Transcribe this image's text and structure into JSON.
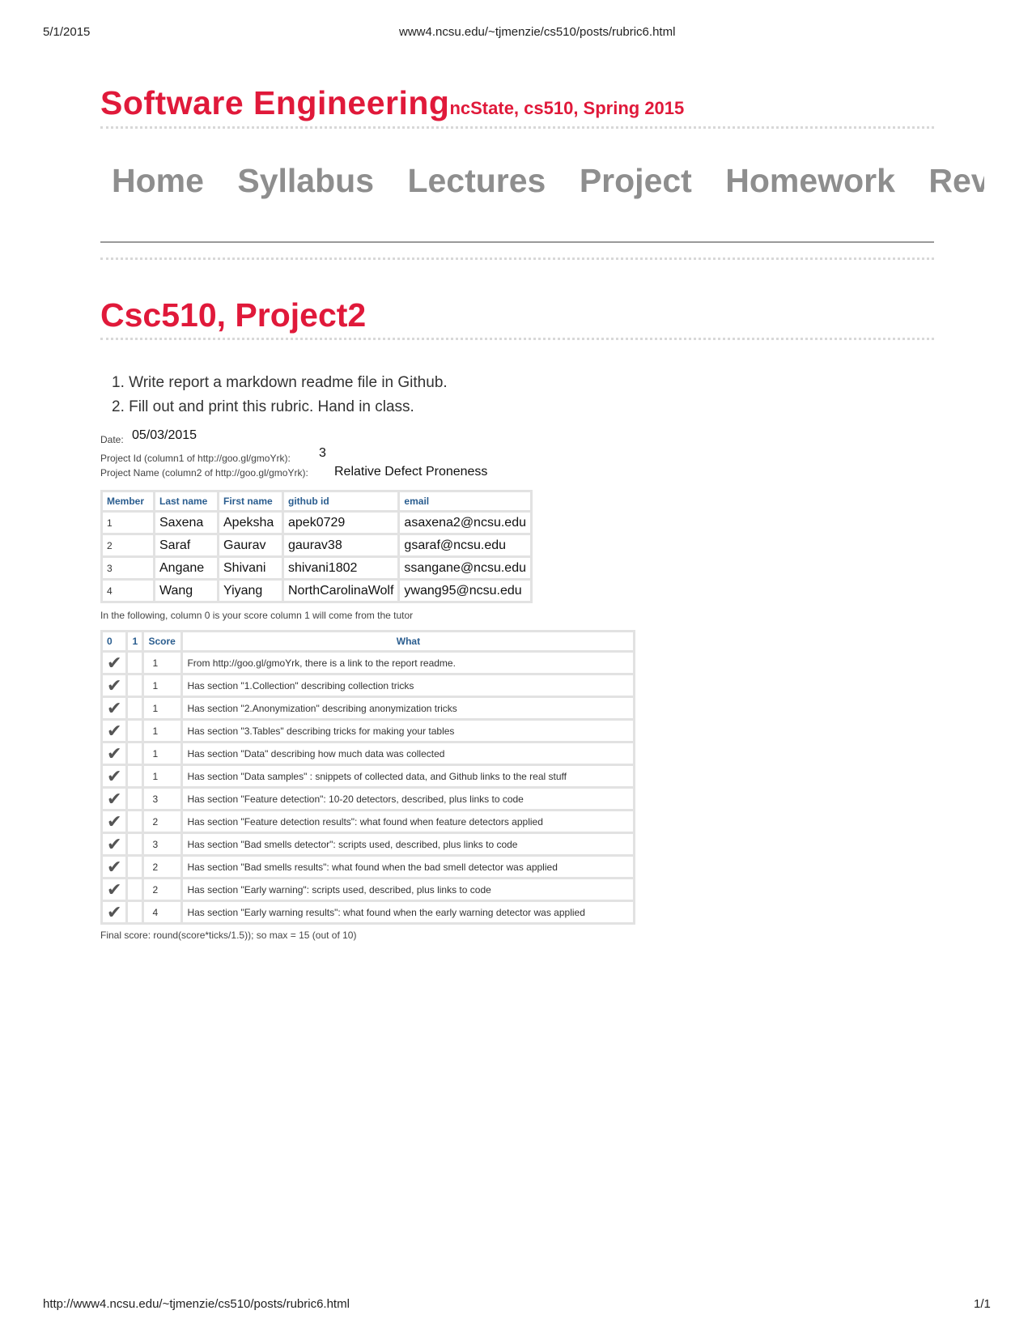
{
  "print_header": {
    "date": "5/1/2015",
    "url": "www4.ncsu.edu/~tjmenzie/cs510/posts/rubric6.html"
  },
  "print_footer": {
    "url": "http://www4.ncsu.edu/~tjmenzie/cs510/posts/rubric6.html",
    "page": "1/1"
  },
  "site": {
    "title": "Software Engineering",
    "subtitle": "ncState, cs510, Spring 2015",
    "accent_color": "#e0193a"
  },
  "nav": [
    "Home",
    "Syllabus",
    "Lectures",
    "Project",
    "Homework",
    "Revi"
  ],
  "page_title": "Csc510, Project2",
  "steps": [
    "1.  Write report a markdown readme file in Github.",
    "2.  Fill out and print this rubric. Hand in class."
  ],
  "form": {
    "date_label": "Date:",
    "date_value": "05/03/2015",
    "project_id_label": "Project Id (column1 of http://goo.gl/gmoYrk):",
    "project_id_value": "3",
    "project_name_label": "Project Name (column2 of http://goo.gl/gmoYrk):",
    "project_name_value": "Relative Defect Proneness"
  },
  "members": {
    "headers": [
      "Member",
      "Last name",
      "First name",
      "github id",
      "email"
    ],
    "rows": [
      [
        "1",
        "Saxena",
        "Apeksha",
        "apek0729",
        "asaxena2@ncsu.edu"
      ],
      [
        "2",
        "Saraf",
        "Gaurav",
        "gaurav38",
        "gsaraf@ncsu.edu"
      ],
      [
        "3",
        "Angane",
        "Shivani",
        "shivani1802",
        "ssangane@ncsu.edu"
      ],
      [
        "4",
        "Wang",
        "Yiyang",
        "NorthCarolinaWolf",
        "ywang95@ncsu.edu"
      ]
    ]
  },
  "note": "In the following, column 0 is your score column 1 will come from the tutor",
  "rubric": {
    "headers": [
      "0",
      "1",
      "Score",
      "What"
    ],
    "check_icon": "✔",
    "rows": [
      {
        "score": "1",
        "what": "From http://goo.gl/gmoYrk, there is a link to the report readme."
      },
      {
        "score": "1",
        "what": "Has section \"1.Collection\" describing collection tricks"
      },
      {
        "score": "1",
        "what": "Has section \"2.Anonymization\" describing anonymization tricks"
      },
      {
        "score": "1",
        "what": "Has section \"3.Tables\" describing tricks for making your tables"
      },
      {
        "score": "1",
        "what": "Has section \"Data\" describing how much data was collected"
      },
      {
        "score": "1",
        "what": "Has section \"Data samples\" : snippets of collected data, and Github links to the real stuff"
      },
      {
        "score": "3",
        "what": "Has section \"Feature detection\": 10-20 detectors, described, plus links to code"
      },
      {
        "score": "2",
        "what": "Has section \"Feature detection results\": what found when feature detectors applied"
      },
      {
        "score": "3",
        "what": "Has section \"Bad smells detector\": scripts used, described, plus links to code"
      },
      {
        "score": "2",
        "what": "Has section \"Bad smells results\": what found when the bad smell detector was applied"
      },
      {
        "score": "2",
        "what": "Has section \"Early warning\": scripts used, described, plus links to code"
      },
      {
        "score": "4",
        "what": "Has section \"Early warning results\": what found when the early warning detector was applied"
      }
    ]
  },
  "final_score": "Final score: round(score*ticks/1.5)); so max = 15 (out of 10)"
}
